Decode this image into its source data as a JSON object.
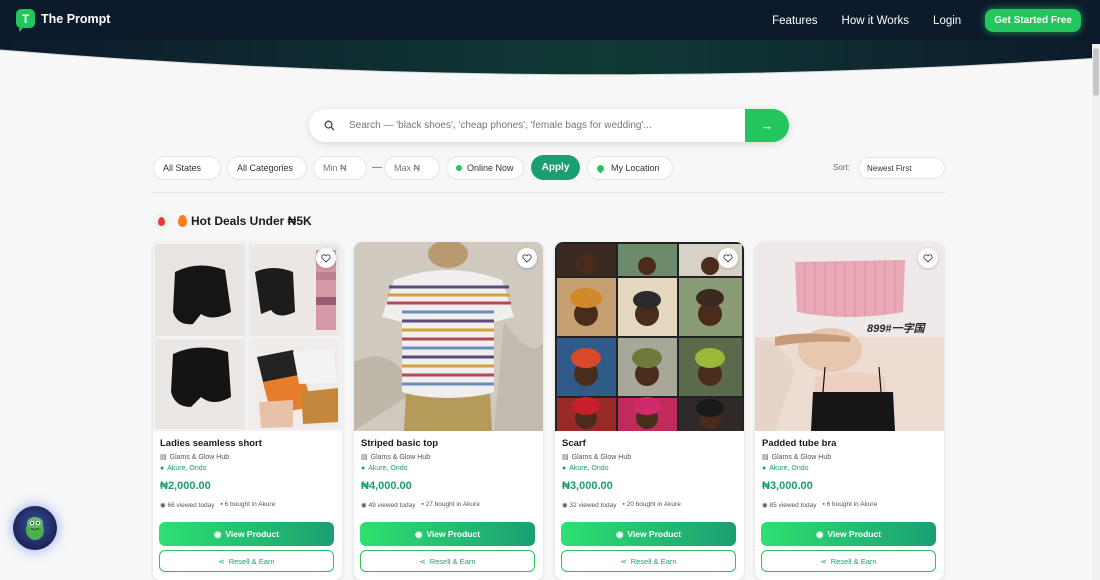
{
  "header": {
    "logo_letter": "T",
    "brand": "The Prompt",
    "nav": [
      "Features",
      "How it Works",
      "Login"
    ],
    "cta": "Get Started Free"
  },
  "search": {
    "placeholder": "Search — 'black shoes', 'cheap phones', 'female bags for wedding'..."
  },
  "filters": {
    "state": "All States",
    "category": "All Categories",
    "min": "Min ₦",
    "max": "Max ₦",
    "online": "Online Now",
    "apply": "Apply",
    "location": "My Location",
    "sort_label": "Sort:",
    "sort_value": "Newest First"
  },
  "section": {
    "title": "Hot Deals Under ₦5K"
  },
  "products": [
    {
      "name": "Ladies seamless short",
      "store": "Glams & Glow Hub",
      "location": "Akure, Ondo",
      "price": "₦2,000.00",
      "views": "66 viewed today",
      "bought": "6 bought in Akure",
      "view_label": "View Product",
      "resell_label": "Resell & Earn"
    },
    {
      "name": "Striped basic top",
      "store": "Glams & Glow Hub",
      "location": "Akure, Ondo",
      "price": "₦4,000.00",
      "views": "49 viewed today",
      "bought": "27 bought in Akure",
      "view_label": "View Product",
      "resell_label": "Resell & Earn"
    },
    {
      "name": "Scarf",
      "store": "Glams & Glow Hub",
      "location": "Akure, Ondo",
      "price": "₦3,000.00",
      "views": "32 viewed today",
      "bought": "20 bought in Akure",
      "view_label": "View Product",
      "resell_label": "Resell & Earn"
    },
    {
      "name": "Padded tube bra",
      "store": "Glams & Glow Hub",
      "location": "Akure, Ondo",
      "price": "₦3,000.00",
      "views": "85 viewed today",
      "bought": "6 bought in Akure",
      "view_label": "View Product",
      "resell_label": "Resell & Earn"
    }
  ],
  "image_overlay_text": "899#一字国",
  "colors": {
    "brand_green": "#22c55e",
    "accent_teal": "#1a9f72",
    "header_navy": "#0d1a2b"
  }
}
